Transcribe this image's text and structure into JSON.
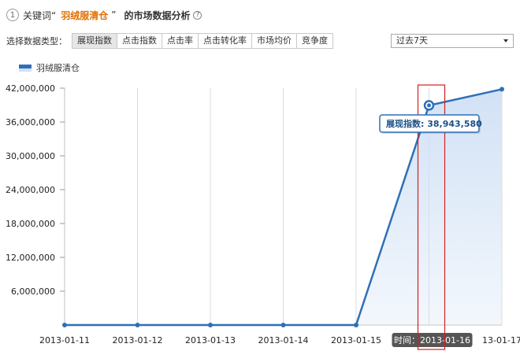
{
  "header": {
    "step": "1",
    "prefix": "关键词“",
    "keyword": "羽绒服清仓",
    "suffix": "”",
    "title": "的市场数据分析",
    "help": "?"
  },
  "toolbar": {
    "label": "选择数据类型：",
    "tabs": [
      {
        "label": "展现指数",
        "active": true
      },
      {
        "label": "点击指数",
        "active": false
      },
      {
        "label": "点击率",
        "active": false
      },
      {
        "label": "点击转化率",
        "active": false
      },
      {
        "label": "市场均价",
        "active": false
      },
      {
        "label": "竞争度",
        "active": false
      }
    ],
    "period": "过去7天"
  },
  "colors": {
    "line": "#2f6fb8",
    "area": "#cfe0f5",
    "highlight": "#d32020",
    "tooltip_border": "#2f6fb8",
    "x_label_bg": "#555555"
  },
  "chart_data": {
    "type": "area",
    "legend": "羽绒服清仓",
    "x": [
      "2013-01-11",
      "2013-01-12",
      "2013-01-13",
      "2013-01-14",
      "2013-01-15",
      "2013-01-16",
      "2013-01-17"
    ],
    "x_tick_labels": [
      "2013-01-11",
      "2013-01-12",
      "2013-01-13",
      "2013-01-14",
      "2013-01-15",
      "",
      "13-01-17"
    ],
    "series": [
      {
        "name": "羽绒服清仓",
        "values": [
          0,
          0,
          0,
          0,
          0,
          38943580,
          41800000
        ]
      }
    ],
    "yticks": [
      6000000,
      12000000,
      18000000,
      24000000,
      30000000,
      36000000,
      42000000
    ],
    "ytick_labels": [
      "6,000,000",
      "12,000,000",
      "18,000,000",
      "24,000,000",
      "30,000,000",
      "36,000,000",
      "42,000,000"
    ],
    "ylim": [
      0,
      42000000
    ],
    "grid": "vertical",
    "highlight_index": 5,
    "tooltip": {
      "label": "展现指数:",
      "value": "38,943,580"
    },
    "hover_x_label": {
      "prefix": "时间：",
      "value": "2013-01-16"
    }
  }
}
